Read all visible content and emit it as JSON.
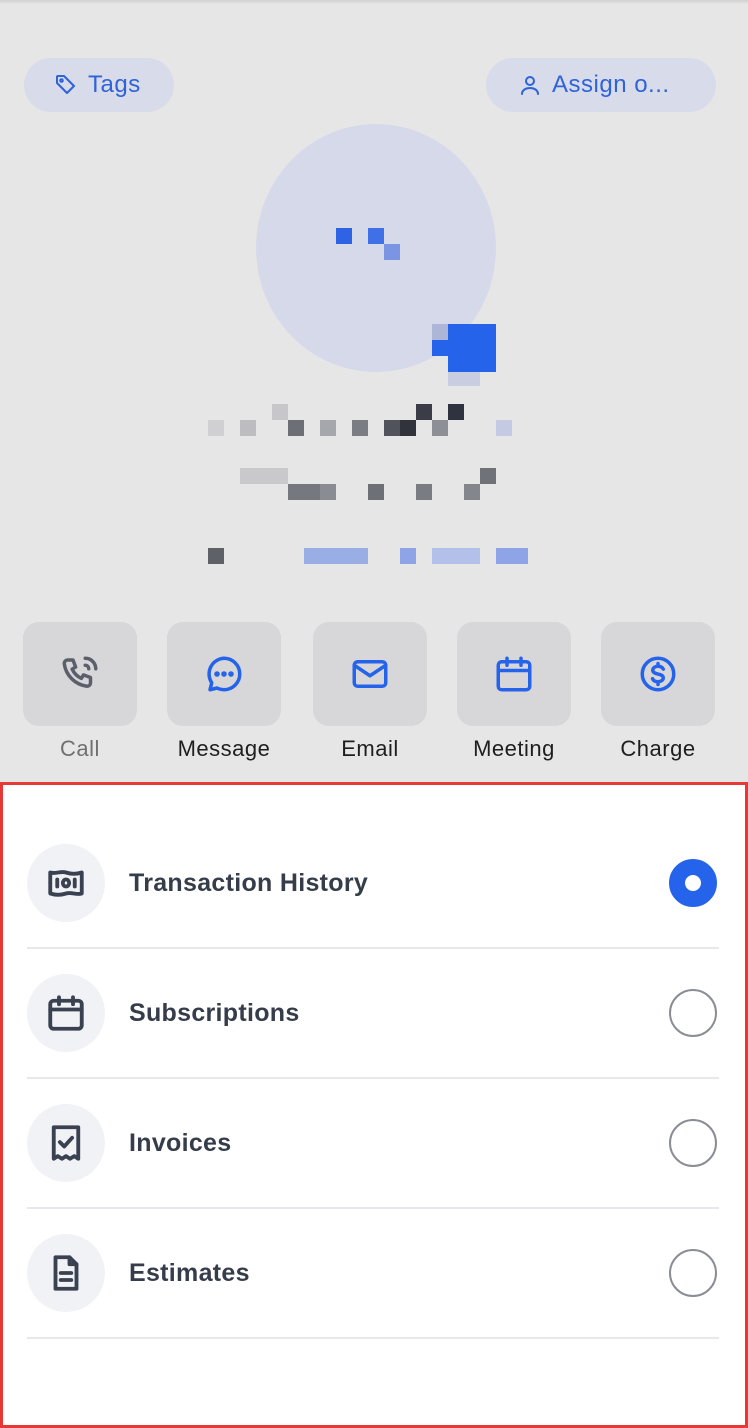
{
  "header": {
    "tags_label": "Tags",
    "assign_label": "Assign o..."
  },
  "colors": {
    "accent": "#2563eb",
    "highlight_border": "#e53935"
  },
  "actions": [
    {
      "label": "Call",
      "icon": "phone-icon",
      "enabled": false
    },
    {
      "label": "Message",
      "icon": "chat-bubble-icon",
      "enabled": true
    },
    {
      "label": "Email",
      "icon": "mail-icon",
      "enabled": true
    },
    {
      "label": "Meeting",
      "icon": "calendar-icon",
      "enabled": true
    },
    {
      "label": "Charge",
      "icon": "dollar-circle-icon",
      "enabled": true
    }
  ],
  "menu": {
    "items": [
      {
        "label": "Transaction History",
        "icon": "banknote-icon",
        "selected": true
      },
      {
        "label": "Subscriptions",
        "icon": "calendar-icon",
        "selected": false
      },
      {
        "label": "Invoices",
        "icon": "receipt-check-icon",
        "selected": false
      },
      {
        "label": "Estimates",
        "icon": "document-icon",
        "selected": false
      }
    ]
  }
}
